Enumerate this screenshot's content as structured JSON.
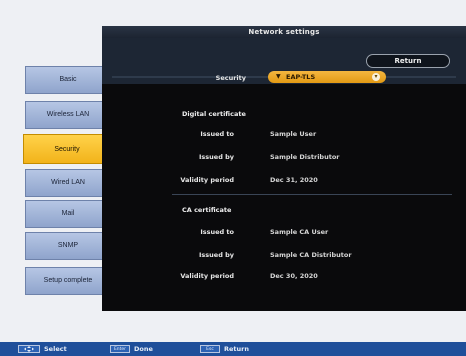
{
  "window": {
    "title": "Network settings"
  },
  "header": {
    "return_label": "Return"
  },
  "security_row": {
    "label": "Security",
    "value": "EAP-TLS"
  },
  "digital_certificate": {
    "heading": "Digital certificate",
    "issued_to_label": "Issued to",
    "issued_to_value": "Sample User",
    "issued_by_label": "Issued by",
    "issued_by_value": "Sample Distributor",
    "validity_label": "Validity period",
    "validity_value": "Dec 31, 2020"
  },
  "ca_certificate": {
    "heading": "CA certificate",
    "issued_to_label": "Issued to",
    "issued_to_value": "Sample CA User",
    "issued_by_label": "Issued by",
    "issued_by_value": "Sample CA Distributor",
    "validity_label": "Validity period",
    "validity_value": "Dec 30, 2020"
  },
  "sidebar": {
    "items": [
      {
        "label": "Basic",
        "active": false
      },
      {
        "label": "Wireless LAN",
        "active": false
      },
      {
        "label": "Security",
        "active": true
      },
      {
        "label": "Wired LAN",
        "active": false
      },
      {
        "label": "Mail",
        "active": false
      },
      {
        "label": "SNMP",
        "active": false
      },
      {
        "label": "Setup complete",
        "active": false
      }
    ]
  },
  "helpbar": {
    "select_label": "Select",
    "enter_key": "Enter",
    "done_label": "Done",
    "esc_key": "Esc",
    "return_label": "Return"
  },
  "colors": {
    "panel": "#0a0a0c",
    "accent_orange": "#f2b31a",
    "menu_blue": "#a2b4d8",
    "helpbar": "#1f4f9a"
  }
}
